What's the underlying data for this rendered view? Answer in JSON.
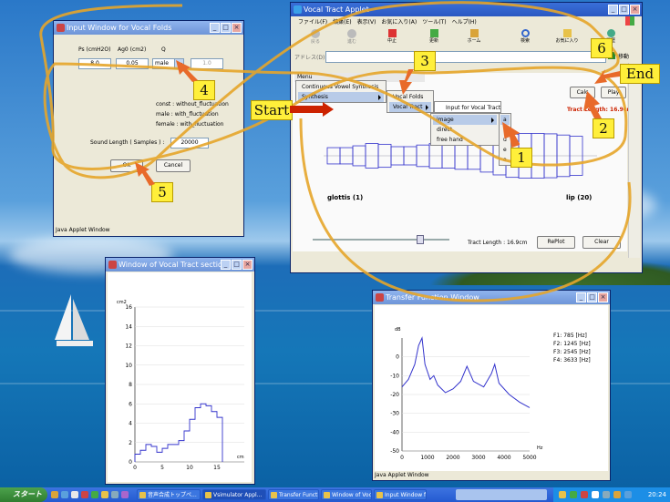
{
  "colors": {
    "accent_red": "#cc2200",
    "callout_yellow": "#ffef3a",
    "plot_line": "#3333cc"
  },
  "folds_window": {
    "title": "Input Window for Vocal Folds",
    "labels": {
      "ps": "Ps (cmH2O)",
      "ag0": "Ag0 (cm2)",
      "q": "Q"
    },
    "values": {
      "ps": "8.0",
      "ag0": "0.05",
      "gender": "male",
      "q": "1.0"
    },
    "descriptions": [
      "const : without_fluctuation",
      "male : with_fluctuation",
      "female : with_fluctuation"
    ],
    "sound_length_label": "Sound Length ( Samples ) :",
    "sound_length_value": "20000",
    "ok": "OK",
    "cancel": "Cancel",
    "status": "Java Applet Window"
  },
  "browser": {
    "title": "Vocal Tract Applet",
    "menubar": [
      "ファイル(F)",
      "編集(E)",
      "表示(V)",
      "お気に入り(A)",
      "ツール(T)",
      "ヘルプ(H)"
    ],
    "toolbar": [
      "戻る",
      "進む",
      "中止",
      "更新",
      "ホーム",
      "検索",
      "お気に入り",
      "履歴"
    ],
    "address_label": "アドレス(D)",
    "go_label": "移動",
    "applet": {
      "menu_title": "Menu",
      "menu_items": [
        "Continuous Vowel Synthesis",
        "Synthesis"
      ],
      "submenu1": [
        "Vocal Folds",
        "Vocal Tract"
      ],
      "submenu2": [
        "Input for Vocal Tract",
        "image",
        "direct",
        "free hand"
      ],
      "vowels": [
        "a",
        "i",
        "u",
        "e",
        "o"
      ],
      "calc": "Calc",
      "play": "Play",
      "tract_length_top": "Tract Length: 16.9cm",
      "glottis": "glottis (1)",
      "lip": "lip (20)",
      "tract_length_bottom": "Tract Length : 16.9cm",
      "replot": "RePlot",
      "clear": "Clear"
    }
  },
  "section_window": {
    "title": "Window of Vocal Tract section",
    "unit_y": "cm2",
    "unit_x": "cm",
    "chart_data": {
      "type": "line",
      "step": true,
      "x": [
        0,
        1,
        2,
        3,
        4,
        5,
        6,
        7,
        8,
        9,
        10,
        11,
        12,
        13,
        14,
        15,
        16
      ],
      "y": [
        0.8,
        1.2,
        1.8,
        1.6,
        1.0,
        1.4,
        1.8,
        1.8,
        2.2,
        3.2,
        4.4,
        5.6,
        6.0,
        5.8,
        5.2,
        4.6,
        0
      ],
      "xlim": [
        0,
        20
      ],
      "ylim": [
        0,
        16
      ],
      "xticks": [
        "0",
        "5",
        "10",
        "15"
      ],
      "yticks": [
        "0",
        "2",
        "4",
        "6",
        "8",
        "10",
        "12",
        "14",
        "16"
      ]
    }
  },
  "transfer_window": {
    "title": "Transfer Function Window",
    "unit_y": "dB",
    "unit_x": "Hz",
    "formants": [
      "F1: 785 [Hz]",
      "F2: 1245 [Hz]",
      "F3: 2545 [Hz]",
      "F4: 3633 [Hz]"
    ],
    "status": "Java Applet Window",
    "chart_data": {
      "type": "line",
      "x": [
        0,
        250,
        500,
        650,
        785,
        900,
        1100,
        1245,
        1400,
        1700,
        2000,
        2300,
        2545,
        2800,
        3200,
        3500,
        3633,
        3800,
        4200,
        4600,
        5000
      ],
      "y": [
        -16,
        -12,
        -4,
        6,
        10,
        -4,
        -12,
        -10,
        -15,
        -19,
        -17,
        -13,
        -5,
        -13,
        -16,
        -9,
        -4,
        -14,
        -20,
        -24,
        -27
      ],
      "xlim": [
        0,
        5000
      ],
      "ylim": [
        -50,
        10
      ],
      "xticks": [
        "0",
        "1000",
        "2000",
        "3000",
        "4000",
        "5000"
      ],
      "yticks": [
        "-50",
        "-40",
        "-30",
        "-20",
        "-10",
        "0"
      ]
    }
  },
  "callouts": {
    "start": "Start",
    "end": "End",
    "n1": "1",
    "n2": "2",
    "n3": "3",
    "n4": "4",
    "n5": "5",
    "n6": "6"
  },
  "taskbar": {
    "start": "スタート",
    "tasks": [
      "音声合成トップペ...",
      "Vsimulator Appl...",
      "Transfer Functi...",
      "Window of Voca...",
      "Input Window fo..."
    ],
    "clock": "20:24"
  }
}
